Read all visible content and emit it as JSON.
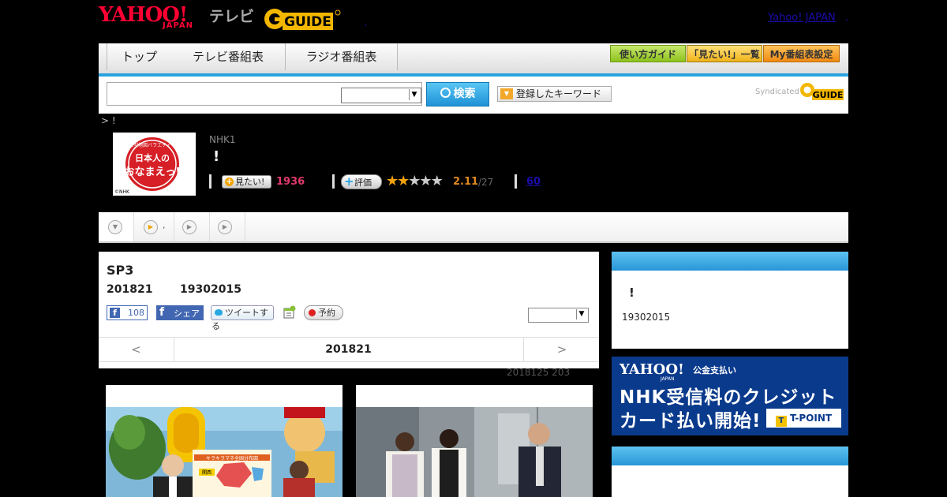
{
  "header": {
    "logo_yahoo": "YAHOO!",
    "logo_japan": "JAPAN",
    "logo_tv": "テレビ",
    "logo_guide": "GUIDE",
    "yahoo_japan_link": "Yahoo! JAPAN",
    "link_dot": ".",
    "small_dot": ","
  },
  "nav": {
    "tabs": [
      {
        "label": "トップ"
      },
      {
        "label": "テレビ番組表"
      },
      {
        "label": "ラジオ番組表"
      }
    ],
    "buttons": [
      {
        "label": "使い方ガイド"
      },
      {
        "label": "「見たい!」一覧"
      },
      {
        "label": "My番組表設定"
      }
    ]
  },
  "search": {
    "placeholder": "",
    "button_label": "検索",
    "keyword_button": "登録したキーワード",
    "syndicated": "Syndicated",
    "syndicated_logo": "GUIDE"
  },
  "breadcrumb": "> !",
  "program": {
    "thumb_top": "大型地図バラエティー",
    "thumb_title": "日本人の",
    "thumb_name": "おなまえっ!",
    "thumb_credit": "©NHK",
    "channel": "NHK1",
    "title": "!",
    "mitai_label": "見たい!",
    "mitai_count": "1936",
    "hyoka_label": "評価",
    "rating": "2.11",
    "rating_total": "/27",
    "rating_value": 2.11,
    "link_count": "60"
  },
  "subtabs": [
    {
      "label": ""
    },
    {
      "label": ","
    },
    {
      "label": ""
    },
    {
      "label": ""
    }
  ],
  "episode": {
    "title": "SP3",
    "date": "201821",
    "time": "19302015",
    "fb_count": "108",
    "fb_share": "シェア",
    "tweet": "ツイートする",
    "reserve": "予約",
    "nav_prev": "<",
    "nav_date": "201821",
    "nav_next": ">",
    "note": "2018125  203"
  },
  "right": {
    "title": "!",
    "time": "19302015"
  },
  "ad": {
    "yahoo": "YAHOO!",
    "japan": "JAPAN",
    "kokin": "公金支払い",
    "line1": "NHK受信料のクレジット",
    "line2": "カード払い開始!",
    "tpoint": "T-POINT"
  },
  "photo1": {
    "map_label": "キラキラマネ全国分布図",
    "map_city": "関西"
  },
  "colors": {
    "accent": "#29a3e0",
    "nav_blue": "#1d92d6",
    "mitai": "#e0396c",
    "rating": "#e08a1f",
    "ad_bg": "#0a3a8c"
  }
}
